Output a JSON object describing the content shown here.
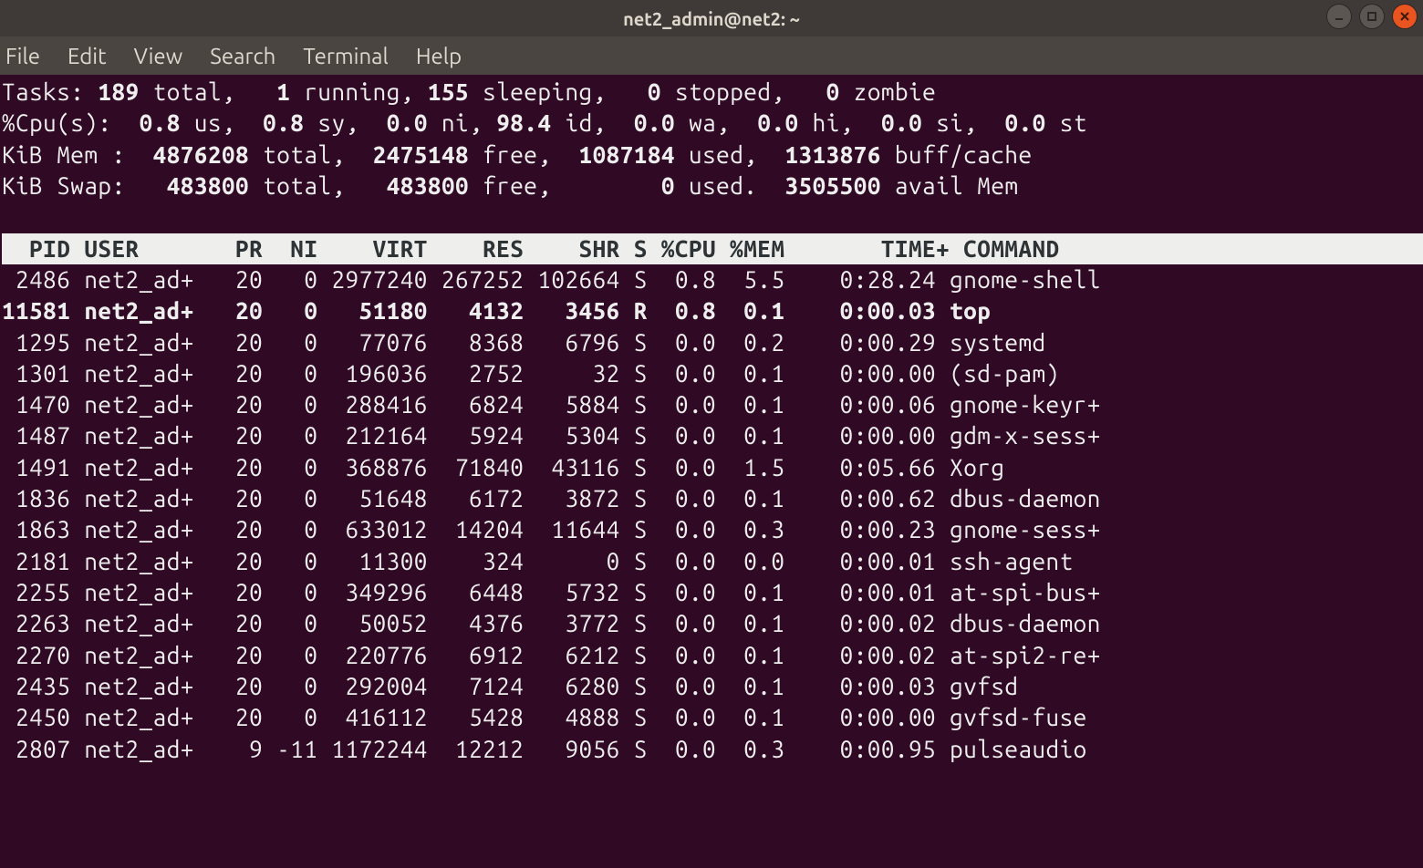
{
  "window": {
    "title": "net2_admin@net2: ~"
  },
  "menu": {
    "file": "File",
    "edit": "Edit",
    "view": "View",
    "search": "Search",
    "terminal": "Terminal",
    "help": "Help"
  },
  "summary": {
    "tasks": {
      "label": "Tasks:",
      "total": "189",
      "total_lbl": "total,",
      "running": "1",
      "running_lbl": "running,",
      "sleeping": "155",
      "sleeping_lbl": "sleeping,",
      "stopped": "0",
      "stopped_lbl": "stopped,",
      "zombie": "0",
      "zombie_lbl": "zombie"
    },
    "cpu": {
      "label": "%Cpu(s):",
      "us": "0.8",
      "us_lbl": "us,",
      "sy": "0.8",
      "sy_lbl": "sy,",
      "ni": "0.0",
      "ni_lbl": "ni,",
      "id": "98.4",
      "id_lbl": "id,",
      "wa": "0.0",
      "wa_lbl": "wa,",
      "hi": "0.0",
      "hi_lbl": "hi,",
      "si": "0.0",
      "si_lbl": "si,",
      "st": "0.0",
      "st_lbl": "st"
    },
    "mem": {
      "label": "KiB Mem :",
      "total": "4876208",
      "total_lbl": "total,",
      "free": "2475148",
      "free_lbl": "free,",
      "used": "1087184",
      "used_lbl": "used,",
      "buff": "1313876",
      "buff_lbl": "buff/cache"
    },
    "swap": {
      "label": "KiB Swap:",
      "total": "483800",
      "total_lbl": "total,",
      "free": "483800",
      "free_lbl": "free,",
      "used": "0",
      "used_lbl": "used.",
      "avail": "3505500",
      "avail_lbl": "avail Mem"
    }
  },
  "columns": {
    "pid": "PID",
    "user": "USER",
    "pr": "PR",
    "ni": "NI",
    "virt": "VIRT",
    "res": "RES",
    "shr": "SHR",
    "s": "S",
    "cpu": "%CPU",
    "mem": "%MEM",
    "time": "TIME+",
    "command": "COMMAND"
  },
  "processes": [
    {
      "pid": "2486",
      "user": "net2_ad+",
      "pr": "20",
      "ni": "0",
      "virt": "2977240",
      "res": "267252",
      "shr": "102664",
      "s": "S",
      "cpu": "0.8",
      "mem": "5.5",
      "time": "0:28.24",
      "command": "gnome-shell",
      "running": false
    },
    {
      "pid": "11581",
      "user": "net2_ad+",
      "pr": "20",
      "ni": "0",
      "virt": "51180",
      "res": "4132",
      "shr": "3456",
      "s": "R",
      "cpu": "0.8",
      "mem": "0.1",
      "time": "0:00.03",
      "command": "top",
      "running": true
    },
    {
      "pid": "1295",
      "user": "net2_ad+",
      "pr": "20",
      "ni": "0",
      "virt": "77076",
      "res": "8368",
      "shr": "6796",
      "s": "S",
      "cpu": "0.0",
      "mem": "0.2",
      "time": "0:00.29",
      "command": "systemd",
      "running": false
    },
    {
      "pid": "1301",
      "user": "net2_ad+",
      "pr": "20",
      "ni": "0",
      "virt": "196036",
      "res": "2752",
      "shr": "32",
      "s": "S",
      "cpu": "0.0",
      "mem": "0.1",
      "time": "0:00.00",
      "command": "(sd-pam)",
      "running": false
    },
    {
      "pid": "1470",
      "user": "net2_ad+",
      "pr": "20",
      "ni": "0",
      "virt": "288416",
      "res": "6824",
      "shr": "5884",
      "s": "S",
      "cpu": "0.0",
      "mem": "0.1",
      "time": "0:00.06",
      "command": "gnome-keyr+",
      "running": false
    },
    {
      "pid": "1487",
      "user": "net2_ad+",
      "pr": "20",
      "ni": "0",
      "virt": "212164",
      "res": "5924",
      "shr": "5304",
      "s": "S",
      "cpu": "0.0",
      "mem": "0.1",
      "time": "0:00.00",
      "command": "gdm-x-sess+",
      "running": false
    },
    {
      "pid": "1491",
      "user": "net2_ad+",
      "pr": "20",
      "ni": "0",
      "virt": "368876",
      "res": "71840",
      "shr": "43116",
      "s": "S",
      "cpu": "0.0",
      "mem": "1.5",
      "time": "0:05.66",
      "command": "Xorg",
      "running": false
    },
    {
      "pid": "1836",
      "user": "net2_ad+",
      "pr": "20",
      "ni": "0",
      "virt": "51648",
      "res": "6172",
      "shr": "3872",
      "s": "S",
      "cpu": "0.0",
      "mem": "0.1",
      "time": "0:00.62",
      "command": "dbus-daemon",
      "running": false
    },
    {
      "pid": "1863",
      "user": "net2_ad+",
      "pr": "20",
      "ni": "0",
      "virt": "633012",
      "res": "14204",
      "shr": "11644",
      "s": "S",
      "cpu": "0.0",
      "mem": "0.3",
      "time": "0:00.23",
      "command": "gnome-sess+",
      "running": false
    },
    {
      "pid": "2181",
      "user": "net2_ad+",
      "pr": "20",
      "ni": "0",
      "virt": "11300",
      "res": "324",
      "shr": "0",
      "s": "S",
      "cpu": "0.0",
      "mem": "0.0",
      "time": "0:00.01",
      "command": "ssh-agent",
      "running": false
    },
    {
      "pid": "2255",
      "user": "net2_ad+",
      "pr": "20",
      "ni": "0",
      "virt": "349296",
      "res": "6448",
      "shr": "5732",
      "s": "S",
      "cpu": "0.0",
      "mem": "0.1",
      "time": "0:00.01",
      "command": "at-spi-bus+",
      "running": false
    },
    {
      "pid": "2263",
      "user": "net2_ad+",
      "pr": "20",
      "ni": "0",
      "virt": "50052",
      "res": "4376",
      "shr": "3772",
      "s": "S",
      "cpu": "0.0",
      "mem": "0.1",
      "time": "0:00.02",
      "command": "dbus-daemon",
      "running": false
    },
    {
      "pid": "2270",
      "user": "net2_ad+",
      "pr": "20",
      "ni": "0",
      "virt": "220776",
      "res": "6912",
      "shr": "6212",
      "s": "S",
      "cpu": "0.0",
      "mem": "0.1",
      "time": "0:00.02",
      "command": "at-spi2-re+",
      "running": false
    },
    {
      "pid": "2435",
      "user": "net2_ad+",
      "pr": "20",
      "ni": "0",
      "virt": "292004",
      "res": "7124",
      "shr": "6280",
      "s": "S",
      "cpu": "0.0",
      "mem": "0.1",
      "time": "0:00.03",
      "command": "gvfsd",
      "running": false
    },
    {
      "pid": "2450",
      "user": "net2_ad+",
      "pr": "20",
      "ni": "0",
      "virt": "416112",
      "res": "5428",
      "shr": "4888",
      "s": "S",
      "cpu": "0.0",
      "mem": "0.1",
      "time": "0:00.00",
      "command": "gvfsd-fuse",
      "running": false
    },
    {
      "pid": "2807",
      "user": "net2_ad+",
      "pr": "9",
      "ni": "-11",
      "virt": "1172244",
      "res": "12212",
      "shr": "9056",
      "s": "S",
      "cpu": "0.0",
      "mem": "0.3",
      "time": "0:00.95",
      "command": "pulseaudio",
      "running": false
    }
  ]
}
